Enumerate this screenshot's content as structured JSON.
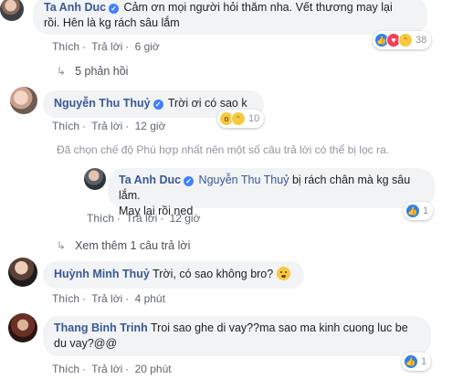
{
  "comments": [
    {
      "author": "Ta Anh Duc",
      "verified": true,
      "text_line1": "Cảm ơn mọi người hỏi thăm nha. Vết thương may lại",
      "text_line2": "rồi. Hên là kg rách sâu lắm",
      "like": "Thích",
      "reply": "Trả lời",
      "time": "6 giờ",
      "reaction_count": "38",
      "reactions": [
        "like-icon",
        "love-icon",
        "haha-icon"
      ],
      "replies_link": "5 phản hồi"
    },
    {
      "author": "Nguyễn Thu Thuỷ",
      "verified": true,
      "text": "Trời ơi có sao k",
      "like": "Thích",
      "reply": "Trả lời",
      "time": "12 giờ",
      "reaction_count": "10",
      "reactions": [
        "wow-icon",
        "haha-icon"
      ],
      "filter_notice": "Đã chọn chế độ Phù hợp nhất nên một số câu trả lời có thể bị lọc ra.",
      "nested_reply": {
        "author": "Ta Anh Duc",
        "verified": true,
        "mention": "Nguyễn Thu Thuỷ",
        "text_line1": " bị rách chân mà kg sâu lắm.",
        "text_line2": "May lại rồi ned",
        "like": "Thích",
        "reply": "Trả lời",
        "time": "12 giờ",
        "reaction_count": "1",
        "reactions": [
          "like-icon"
        ]
      },
      "more_replies_link": "Xem thêm 1 câu trả lời"
    },
    {
      "author": "Huỳnh Minh Thuỷ",
      "verified": false,
      "text": "Trời, có sao không bro?",
      "emoji": "worried-face-icon",
      "like": "Thích",
      "reply": "Trả lời",
      "time": "4 phút"
    },
    {
      "author": "Thang Binh Trinh",
      "verified": false,
      "text_line1": "Troi sao ghe di vay??ma sao ma kinh cuong luc be",
      "text_line2": "du vay?@@",
      "like": "Thích",
      "reply": "Trả lời",
      "time": "20 phút",
      "reaction_count": "1",
      "reactions": [
        "like-icon"
      ]
    }
  ],
  "colors": {
    "author_link": "#385898",
    "bubble_bg": "#f2f3f5",
    "meta_text": "#606770",
    "like_blue": "#2f80ed",
    "love_red": "#f33e58",
    "haha_yellow": "#f7c940"
  }
}
